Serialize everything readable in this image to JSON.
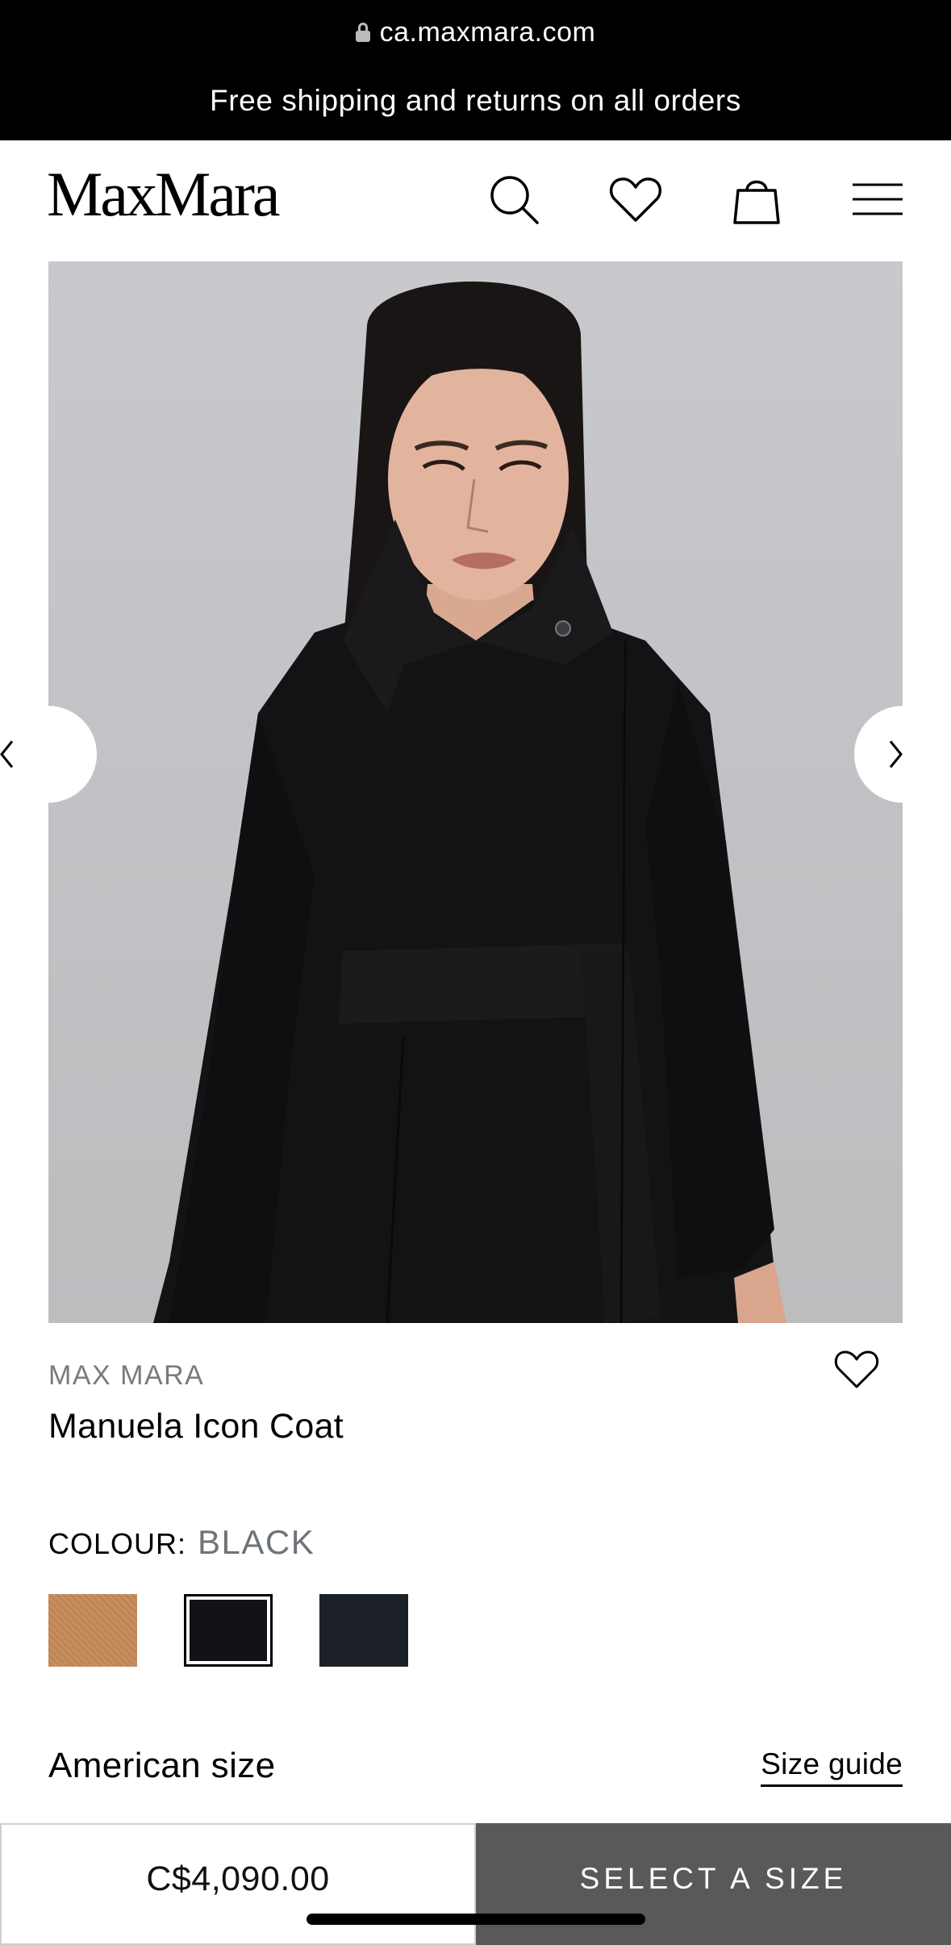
{
  "browser": {
    "url": "ca.maxmara.com",
    "lock_icon": "lock-icon"
  },
  "promo": {
    "text": "Free shipping and returns on all orders"
  },
  "header": {
    "logo": "MaxMara",
    "icons": [
      "search-icon",
      "heart-icon",
      "shopping-bag-icon",
      "menu-icon"
    ]
  },
  "gallery": {
    "image": "model wearing black belted coat",
    "prev_icon": "chevron-left-icon",
    "next_icon": "chevron-right-icon"
  },
  "product": {
    "brand": "MAX MARA",
    "name": "Manuela Icon Coat",
    "wishlist_icon": "heart-icon"
  },
  "colour": {
    "label": "COLOUR:",
    "selected": "BLACK",
    "swatches": [
      {
        "name": "camel",
        "color": "#c58a58",
        "selected": false
      },
      {
        "name": "black",
        "color": "#111215",
        "selected": true
      },
      {
        "name": "midnight blue",
        "color": "#1b2127",
        "selected": false
      }
    ]
  },
  "size": {
    "title": "American size",
    "guide_link": "Size guide"
  },
  "purchase": {
    "price": "C$4,090.00",
    "cta": "SELECT A SIZE"
  }
}
